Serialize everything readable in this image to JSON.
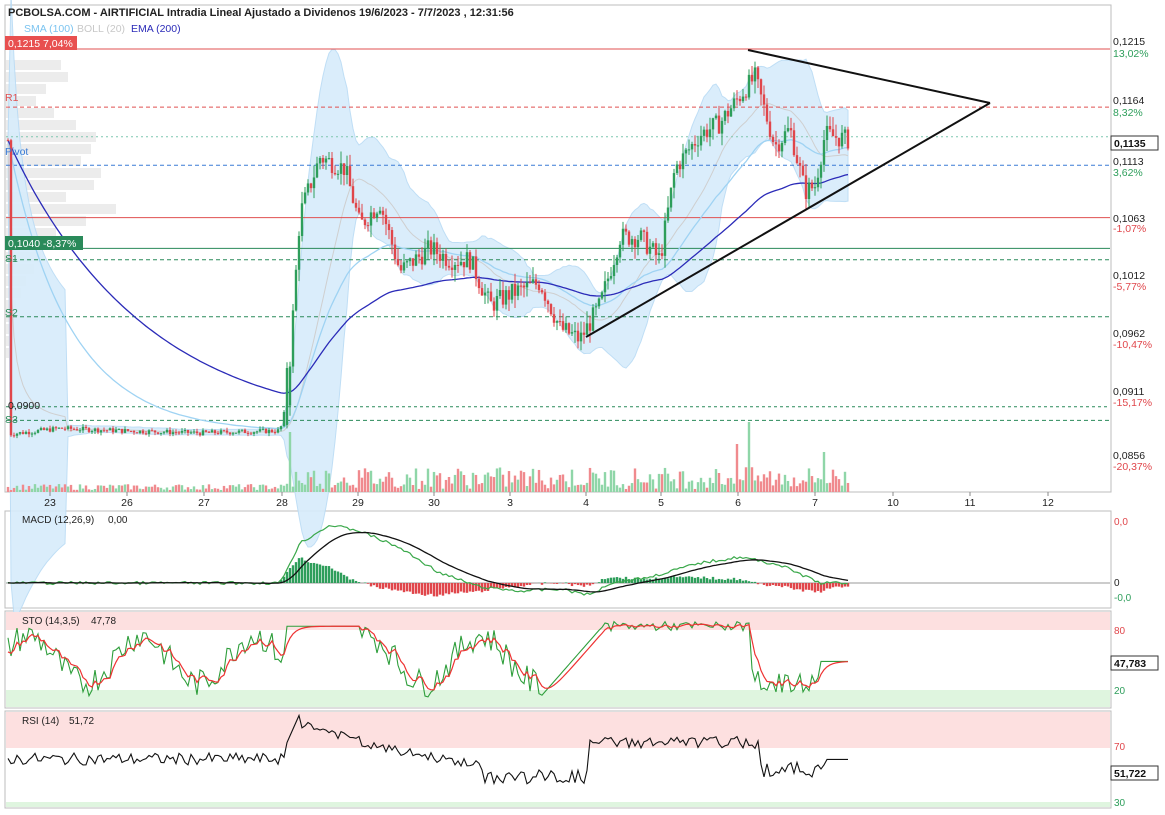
{
  "header": {
    "title": "PCBOLSA.COM - AIRTIFICIAL Intradia Lineal Ajustado a Dividenos 19/6/2023 - 7/7/2023 , 12:31:56",
    "legend": [
      {
        "label": "SMA (100)",
        "color": "#7cc4f0"
      },
      {
        "label": "BOLL (20)",
        "color": "#c8c8c8"
      },
      {
        "label": "EMA (200)",
        "color": "#2b2bb8"
      }
    ]
  },
  "colors": {
    "up": "#2e9e5b",
    "down": "#e0464b",
    "sma": "#9fd3f3",
    "ema": "#2b2bb8",
    "boll_fill": "#d7ecfb",
    "resistance": "#e05050",
    "support": "#2a8a5a",
    "triangle": "#111111"
  },
  "price_labels": {
    "top_box": "0,1215 7,04%",
    "low_box": "0,1040 -8,37%",
    "level_0900": "0,0900",
    "R1": "R1",
    "Pivot": "Pivot",
    "S1": "S1",
    "S2": "S2",
    "S3": "S3",
    "current_box": "0,1135"
  },
  "right_axis": [
    {
      "price": "0,1215",
      "pct": "13,02%",
      "pct_color": "#2e9e5b"
    },
    {
      "price": "0,1164",
      "pct": "8,32%",
      "pct_color": "#2e9e5b"
    },
    {
      "price": "0,1113",
      "pct": "3,62%",
      "pct_color": "#2e9e5b"
    },
    {
      "price": "0,1063",
      "pct": "-1,07%",
      "pct_color": "#e0464b"
    },
    {
      "price": "0,1012",
      "pct": "-5,77%",
      "pct_color": "#e0464b"
    },
    {
      "price": "0,0962",
      "pct": "-10,47%",
      "pct_color": "#e0464b"
    },
    {
      "price": "0,0911",
      "pct": "-15,17%",
      "pct_color": "#e0464b"
    },
    {
      "price": "0,0856",
      "pct": "-20,37%",
      "pct_color": "#e0464b"
    }
  ],
  "x_axis": [
    "23",
    "26",
    "27",
    "28",
    "29",
    "30",
    "3",
    "4",
    "5",
    "6",
    "7",
    "10",
    "11",
    "12"
  ],
  "macd": {
    "title": "MACD (12,26,9)",
    "value": "0,00",
    "ticks": [
      "0,0",
      "0",
      "-0,0"
    ]
  },
  "sto": {
    "title": "STO (14,3,5)",
    "value": "47,78",
    "ticks": [
      "80",
      "20"
    ],
    "current": "47,783"
  },
  "rsi": {
    "title": "RSI (14)",
    "value": "51,72",
    "ticks": [
      "70",
      "30"
    ],
    "current": "51,722"
  },
  "chart_data": {
    "type": "candlestick",
    "title": "PCBOLSA.COM - AIRTIFICIAL Intradia Lineal Ajustado a Dividenos 19/6/2023 - 7/7/2023 , 12:31:56",
    "ylim": [
      0.084,
      0.124
    ],
    "x_ticks": [
      "23",
      "26",
      "27",
      "28",
      "29",
      "30",
      "3",
      "4",
      "5",
      "6",
      "7",
      "10",
      "11",
      "12"
    ],
    "levels": {
      "R1": 0.1164,
      "Pivot": 0.1113,
      "S1": 0.103,
      "S2": 0.098,
      "S3": 0.0889,
      "upper_line": 0.1215,
      "mid_line": 0.1067,
      "low_line": 0.104
    },
    "last_price": 0.1135,
    "triangle": {
      "apex_day": "11",
      "apex_price": 0.1164,
      "upper_start": [
        "6",
        0.1215
      ],
      "lower_start": [
        "4",
        0.0962
      ]
    },
    "macd": {
      "last": 0.0
    },
    "sto": {
      "last": 47.78,
      "overbought": 80,
      "oversold": 20
    },
    "rsi": {
      "last": 51.72,
      "overbought": 70,
      "oversold": 30
    }
  }
}
